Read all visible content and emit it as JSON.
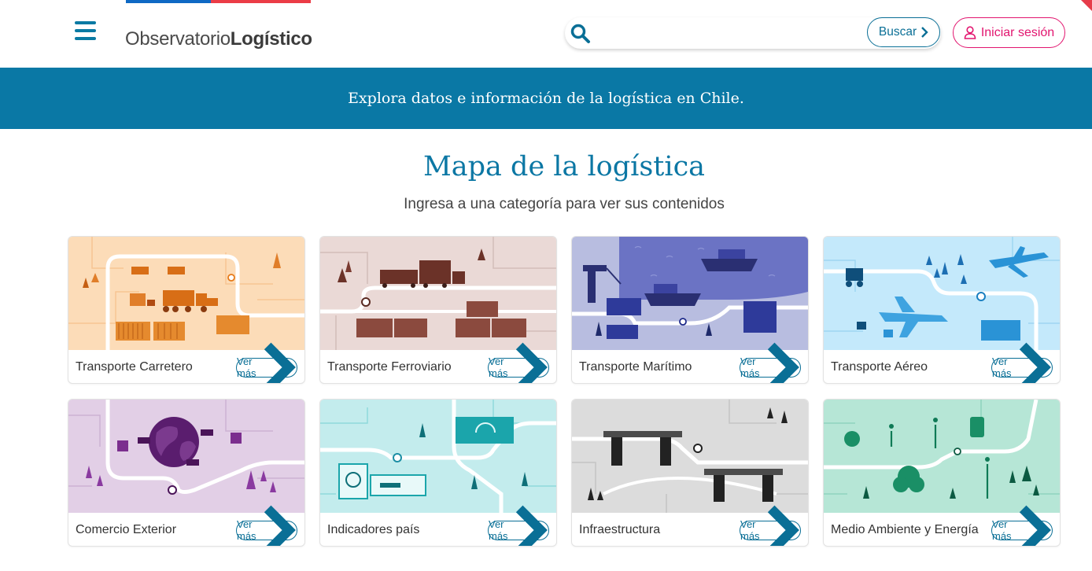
{
  "header": {
    "logo_light": "Observatorio",
    "logo_bold": "Logístico",
    "search_placeholder": "",
    "search_button": "Buscar",
    "login_button": "Iniciar sesión"
  },
  "banner": {
    "text": "Explora datos e información de la logística en Chile."
  },
  "section": {
    "title": "Mapa de la logística",
    "subtitle": "Ingresa a una categoría para ver sus contenidos"
  },
  "cards": [
    {
      "label": "Transporte Carretero",
      "button": "Ver más",
      "color": "#fcdcb8"
    },
    {
      "label": "Transporte Ferroviario",
      "button": "Ver más",
      "color": "#ead9d6"
    },
    {
      "label": "Transporte Marítimo",
      "button": "Ver más",
      "color": "#7b82c9"
    },
    {
      "label": "Transporte Aéreo",
      "button": "Ver más",
      "color": "#c4e9fb"
    },
    {
      "label": "Comercio Exterior",
      "button": "Ver más",
      "color": "#e2cfe6"
    },
    {
      "label": "Indicadores país",
      "button": "Ver más",
      "color": "#c3eced"
    },
    {
      "label": "Infraestructura",
      "button": "Ver más",
      "color": "#dcdcdc"
    },
    {
      "label": "Medio Ambiente y Energía",
      "button": "Ver más",
      "color": "#b6e6d6"
    }
  ],
  "colors": {
    "brand": "#0a78a5",
    "accent": "#e2156f"
  }
}
